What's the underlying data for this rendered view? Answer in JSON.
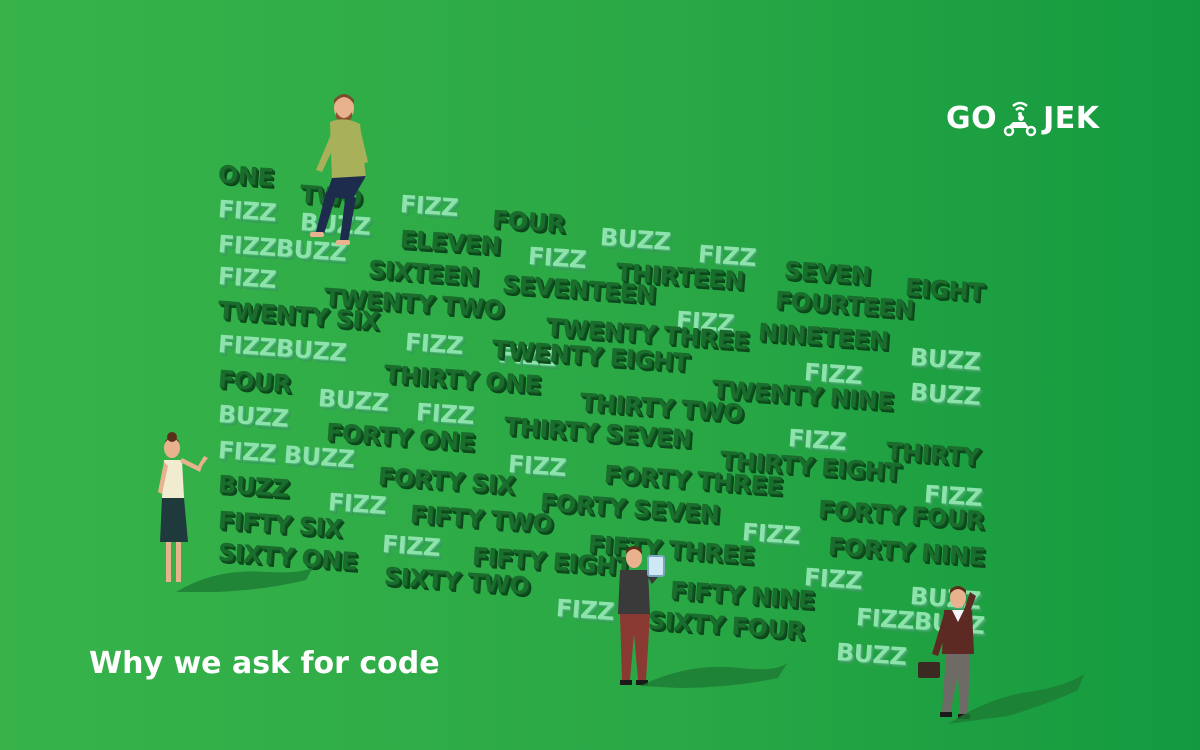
{
  "brand": {
    "logo_left": "GO",
    "logo_right": "JEK",
    "logo_icon": "scooter-rider-wifi-icon"
  },
  "headline": "Why we ask for code",
  "wall_words": [
    {
      "text": "ONE",
      "tone": "dark"
    },
    {
      "text": "TWO",
      "tone": "dark"
    },
    {
      "text": "FIZZ",
      "tone": "light"
    },
    {
      "text": "FOUR",
      "tone": "dark"
    },
    {
      "text": "BUZZ",
      "tone": "light"
    },
    {
      "text": "FIZZ",
      "tone": "light"
    },
    {
      "text": "SEVEN",
      "tone": "dark"
    },
    {
      "text": "EIGHT",
      "tone": "dark"
    },
    {
      "text": "FIZZ",
      "tone": "light"
    },
    {
      "text": "BUZZ",
      "tone": "light"
    },
    {
      "text": "ELEVEN",
      "tone": "dark"
    },
    {
      "text": "FIZZ",
      "tone": "light"
    },
    {
      "text": "THIRTEEN",
      "tone": "dark"
    },
    {
      "text": "FOURTEEN",
      "tone": "dark"
    },
    {
      "text": "FIZZBUZZ",
      "tone": "light"
    },
    {
      "text": "SIXTEEN",
      "tone": "dark"
    },
    {
      "text": "SEVENTEEN",
      "tone": "dark"
    },
    {
      "text": "FIZZ",
      "tone": "light"
    },
    {
      "text": "NINETEEN",
      "tone": "dark"
    },
    {
      "text": "FIZZ",
      "tone": "light"
    },
    {
      "text": "TWENTY TWO",
      "tone": "dark"
    },
    {
      "text": "TWENTY SIX",
      "tone": "dark"
    },
    {
      "text": "TWENTY THREE",
      "tone": "dark"
    },
    {
      "text": "FIZZ",
      "tone": "light"
    },
    {
      "text": "BUZZ",
      "tone": "light"
    },
    {
      "text": "FIZZBUZZ",
      "tone": "light"
    },
    {
      "text": "FIZZ",
      "tone": "light"
    },
    {
      "text": "TWENTY EIGHT",
      "tone": "dark"
    },
    {
      "text": "FIZZ",
      "tone": "light"
    },
    {
      "text": "BUZZ",
      "tone": "light"
    },
    {
      "text": "FOUR",
      "tone": "dark"
    },
    {
      "text": "THIRTY ONE",
      "tone": "dark"
    },
    {
      "text": "TWENTY NINE",
      "tone": "dark"
    },
    {
      "text": "BUZZ",
      "tone": "light"
    },
    {
      "text": "THIRTY TWO",
      "tone": "dark"
    },
    {
      "text": "BUZZ",
      "tone": "light"
    },
    {
      "text": "FIZZ",
      "tone": "light"
    },
    {
      "text": "FORTY ONE",
      "tone": "dark"
    },
    {
      "text": "THIRTY SEVEN",
      "tone": "dark"
    },
    {
      "text": "FIZZ",
      "tone": "light"
    },
    {
      "text": "THIRTY",
      "tone": "dark"
    },
    {
      "text": "FIZZ BUZZ",
      "tone": "light"
    },
    {
      "text": "FIZZ",
      "tone": "light"
    },
    {
      "text": "THIRTY EIGHT",
      "tone": "dark"
    },
    {
      "text": "FORTY SIX",
      "tone": "dark"
    },
    {
      "text": "FORTY THREE",
      "tone": "dark"
    },
    {
      "text": "FIZZ",
      "tone": "light"
    },
    {
      "text": "BUZZ",
      "tone": "dark"
    },
    {
      "text": "FIZZ",
      "tone": "light"
    },
    {
      "text": "FORTY SEVEN",
      "tone": "dark"
    },
    {
      "text": "FORTY FOUR",
      "tone": "dark"
    },
    {
      "text": "FIFTY SIX",
      "tone": "dark"
    },
    {
      "text": "FIFTY TWO",
      "tone": "dark"
    },
    {
      "text": "FIZZ",
      "tone": "light"
    },
    {
      "text": "FIFTY THREE",
      "tone": "dark"
    },
    {
      "text": "FORTY NINE",
      "tone": "dark"
    },
    {
      "text": "SIXTY ONE",
      "tone": "dark"
    },
    {
      "text": "FIZZ",
      "tone": "light"
    },
    {
      "text": "FIFTY EIGHT",
      "tone": "dark"
    },
    {
      "text": "FIZZ",
      "tone": "light"
    },
    {
      "text": "SIXTY TWO",
      "tone": "dark"
    },
    {
      "text": "FIFTY NINE",
      "tone": "dark"
    },
    {
      "text": "BUZZ",
      "tone": "light"
    },
    {
      "text": "FIZZ",
      "tone": "light"
    },
    {
      "text": "SIXTY FOUR",
      "tone": "dark"
    },
    {
      "text": "FIZZBUZZ",
      "tone": "light"
    },
    {
      "text": "BUZZ",
      "tone": "light"
    }
  ],
  "colors": {
    "background_left": "#37b34a",
    "background_right": "#139a3f",
    "word_dark": "#1a6d2c",
    "word_light": "#8ee3ad",
    "headline": "#ffffff"
  }
}
